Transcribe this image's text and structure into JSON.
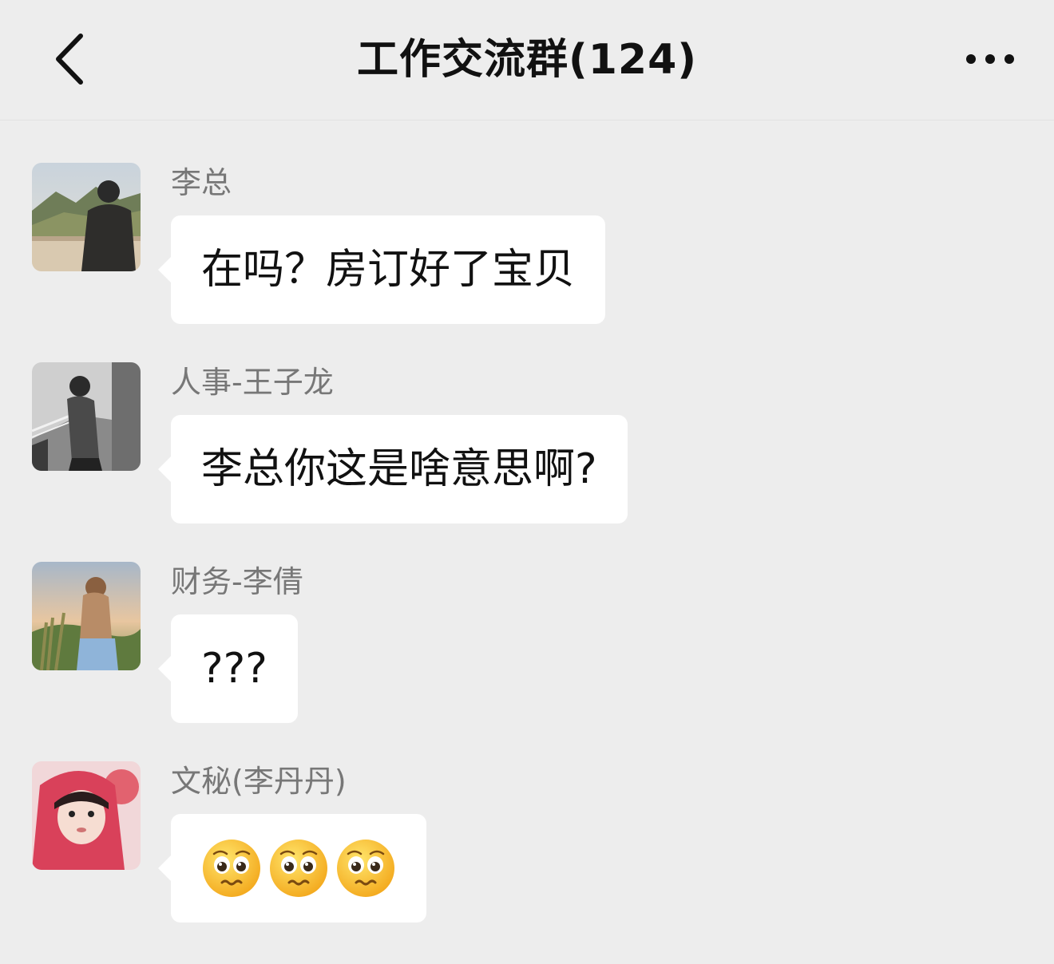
{
  "header": {
    "back_icon": "chevron-left-icon",
    "title": "工作交流群(124)",
    "more_icon": "more-dots-icon"
  },
  "messages": [
    {
      "sender": "李总",
      "text": "在吗？房订好了宝贝",
      "avatar_icon": "avatar-man-mountains"
    },
    {
      "sender": "人事-王子龙",
      "text": "李总你这是啥意思啊?",
      "avatar_icon": "avatar-man-stairs"
    },
    {
      "sender": "财务-李倩",
      "text": "???",
      "avatar_icon": "avatar-woman-sunset"
    },
    {
      "sender": "文秘(李丹丹)",
      "text": "",
      "emojis": [
        "pleading-face-icon",
        "pleading-face-icon",
        "pleading-face-icon"
      ],
      "avatar_icon": "avatar-girl-pink-hood"
    }
  ]
}
